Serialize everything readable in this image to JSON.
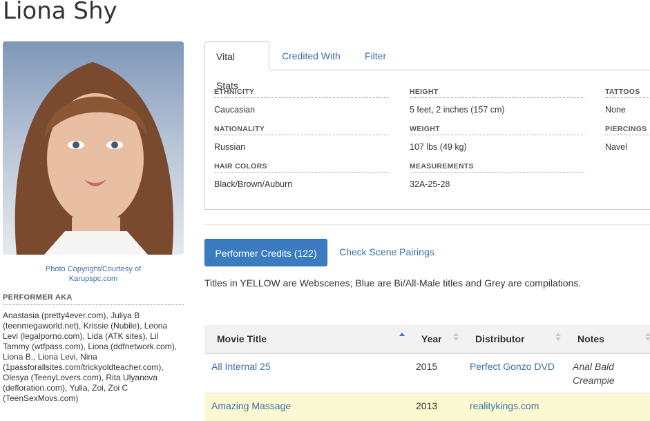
{
  "performer": {
    "name": "Liona Shy",
    "photo_credit_line1": "Photo Copyright/Courtesy of",
    "photo_credit_line2": "Karupspc.com",
    "aka_label": "PERFORMER AKA",
    "aka_text": "Anastasia (pretty4ever.com), Juliya B (teenmegaworld.net), Krissie (Nubile), Leona Levi (legalporno.com), Lida (ATK sites), Lil Tammy (wtfpass.com), Liona (ddfnetwork.com), Liona B., Liona Levi, Nina (1passforallsites.com/trickyoldteacher.com), Olesya (TeenyLovers.com), Rita Ulyanova (defloration.com), Yulia, Zoi, Zoi C (TeenSexMovs.com)"
  },
  "tabs": [
    {
      "label": "Vital Stats",
      "active": true
    },
    {
      "label": "Credited With",
      "active": false
    },
    {
      "label": "Filter",
      "active": false
    }
  ],
  "stats": {
    "ethnicity": {
      "label": "ETHNICITY",
      "value": "Caucasian"
    },
    "nationality": {
      "label": "NATIONALITY",
      "value": "Russian"
    },
    "hair": {
      "label": "HAIR COLORS",
      "value": "Black/Brown/Auburn"
    },
    "height": {
      "label": "HEIGHT",
      "value": "5 feet, 2 inches (157 cm)"
    },
    "weight": {
      "label": "WEIGHT",
      "value": "107 lbs (49 kg)"
    },
    "measurements": {
      "label": "MEASUREMENTS",
      "value": "32A-25-28"
    },
    "tattoos": {
      "label": "TATTOOS",
      "value": "None"
    },
    "piercings": {
      "label": "PIERCINGS",
      "value": "Navel"
    }
  },
  "credits": {
    "primary_button": "Performer Credits (122)",
    "pairings_link": "Check Scene Pairings",
    "legend": "Titles in YELLOW are Webscenes; Blue are Bi/All-Male titles and Grey are compilations."
  },
  "table": {
    "columns": [
      "Movie Title",
      "Year",
      "Distributor",
      "Notes"
    ],
    "rows": [
      {
        "title": "All Internal 25",
        "year": "2015",
        "distributor": "Perfect Gonzo DVD",
        "notes_line1": "Anal Bald",
        "notes_line2": "Creampie"
      },
      {
        "title": "Amazing Massage",
        "year": "2013",
        "distributor": "realitykings.com",
        "notes_line1": "",
        "notes_line2": ""
      }
    ]
  },
  "colors": {
    "link": "#3a6ea5",
    "primary": "#3b7cc0",
    "webscene_row": "#fbf9d2"
  }
}
